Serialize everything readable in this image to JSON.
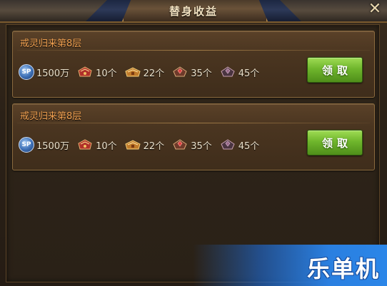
{
  "window": {
    "title": "替身收益",
    "close_icon": "close-icon"
  },
  "colors": {
    "card_title": "#f0a050",
    "claim_button": "#6fb62c",
    "watermark_bg": "#2a7fe0"
  },
  "cards": [
    {
      "title": "戒灵归来第8层",
      "rewards": [
        {
          "icon": "sp-currency-icon",
          "label": "SP",
          "amount": "1500万"
        },
        {
          "icon": "red-chest-icon",
          "amount": "10个"
        },
        {
          "icon": "gold-chest-icon",
          "amount": "22个"
        },
        {
          "icon": "red-gem-chest-icon",
          "amount": "35个"
        },
        {
          "icon": "dark-chest-icon",
          "amount": "45个"
        }
      ],
      "claim_label": "领取"
    },
    {
      "title": "戒灵归来第8层",
      "rewards": [
        {
          "icon": "sp-currency-icon",
          "label": "SP",
          "amount": "1500万"
        },
        {
          "icon": "red-chest-icon",
          "amount": "10个"
        },
        {
          "icon": "gold-chest-icon",
          "amount": "22个"
        },
        {
          "icon": "red-gem-chest-icon",
          "amount": "35个"
        },
        {
          "icon": "dark-chest-icon",
          "amount": "45个"
        }
      ],
      "claim_label": "领取"
    }
  ],
  "watermark": {
    "text": "乐单机"
  }
}
